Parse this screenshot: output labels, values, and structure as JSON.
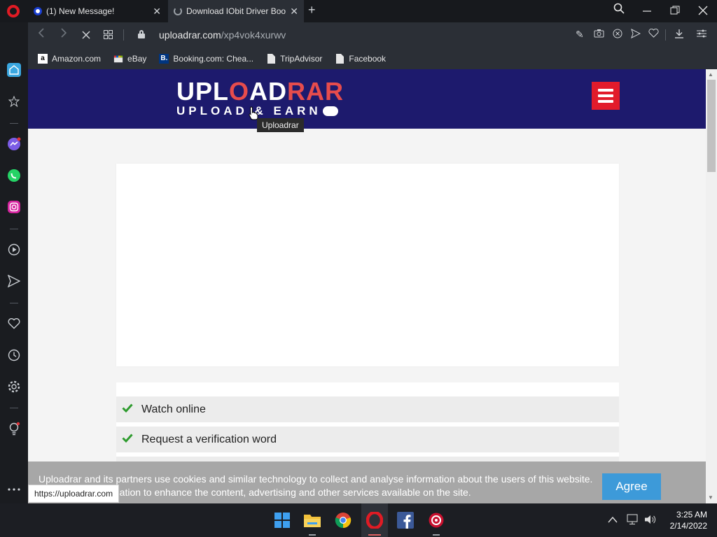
{
  "browser": {
    "tabs": [
      {
        "label": "(1) New Message!",
        "close": "✕"
      },
      {
        "label": "Download IObit Driver Boo",
        "close": "✕"
      }
    ],
    "new_tab": "+",
    "url_host": "uploadrar.com",
    "url_path": "/xp4vok4xurwv",
    "bookmarks": [
      {
        "label": "Amazon.com",
        "icon": "amazon-icon"
      },
      {
        "label": "eBay",
        "icon": "ebay-icon"
      },
      {
        "label": "Booking.com: Chea...",
        "icon": "booking-icon"
      },
      {
        "label": "TripAdvisor",
        "icon": "page-icon"
      },
      {
        "label": "Facebook",
        "icon": "page-icon"
      }
    ],
    "status_url": "https://uploadrar.com"
  },
  "site": {
    "logo_line1_a": "UPL",
    "logo_line1_b": "O",
    "logo_line1_c": "AD",
    "logo_line1_d": "RAR",
    "logo_line2": "UPLOAD & EARN",
    "tooltip": "Uploadrar",
    "header_color": "#1d1a6d",
    "accent_color": "#e21b2b",
    "steps": [
      {
        "label": "Watch online"
      },
      {
        "label": "Request a verification word"
      }
    ],
    "cookie_text": "Uploadrar and its partners use cookies and similar technology to collect and analyse information about the users of this website. We use this information to enhance the content, advertising and other services available on the site.",
    "agree_label": "Agree"
  },
  "taskbar": {
    "time": "3:25 AM",
    "date": "2/14/2022"
  }
}
